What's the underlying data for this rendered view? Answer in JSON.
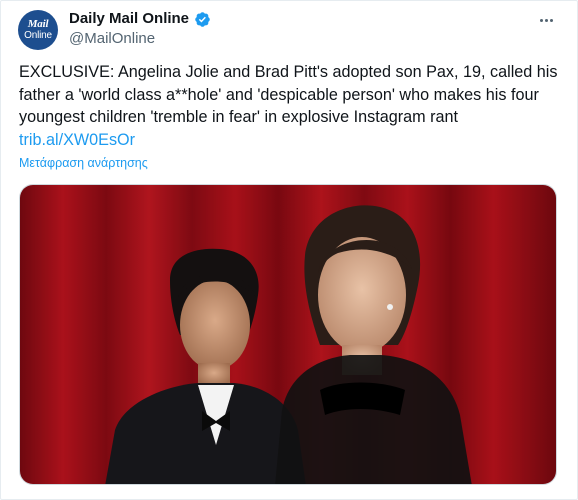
{
  "account": {
    "avatar_line1": "Mail",
    "avatar_line2": "Online",
    "display_name": "Daily Mail Online",
    "handle": "@MailOnline",
    "verified_icon": "verified-badge-icon"
  },
  "tweet": {
    "text": "EXCLUSIVE: Angelina Jolie and Brad Pitt's adopted son Pax, 19, called his father a 'world class a**hole' and 'despicable person' who makes his four youngest children 'tremble in fear' in explosive Instagram rant",
    "link": "trib.al/XW0EsOr",
    "translate_label": "Μετάφραση ανάρτησης"
  },
  "icons": {
    "more": "more-options-icon"
  },
  "colors": {
    "accent": "#1d9bf0",
    "avatar_bg": "#1d4e8f",
    "curtain": "#b0121c",
    "text_primary": "#0f1419",
    "text_secondary": "#536471"
  }
}
